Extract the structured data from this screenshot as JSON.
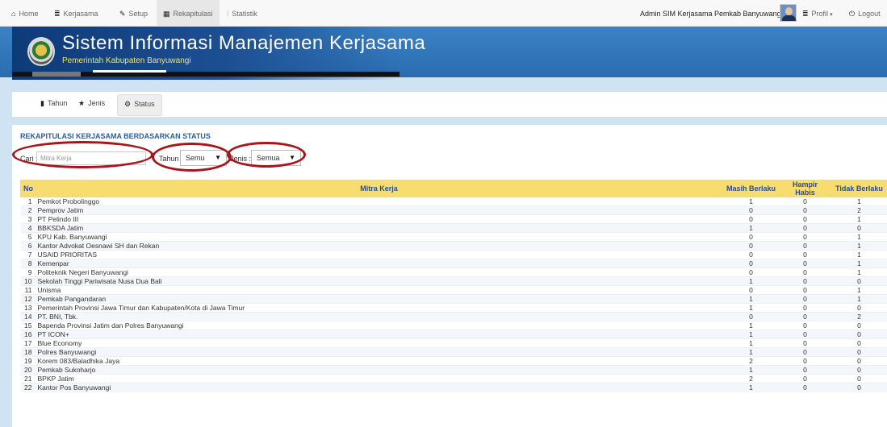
{
  "nav": {
    "items": [
      {
        "icon": "home-icon",
        "glyph": "🏠",
        "label": "Home"
      },
      {
        "icon": "list-icon",
        "glyph": "≣",
        "label": "Kerjasama"
      },
      {
        "icon": "wrench-icon",
        "glyph": "✎",
        "label": "Setup"
      },
      {
        "icon": "table-icon",
        "glyph": "▦",
        "label": "Rekapitulasi"
      },
      {
        "icon": "chart-icon",
        "glyph": "⫶",
        "label": "Statistik"
      }
    ],
    "admin_name": "Admin SIM Kerjasama Pemkab Banyuwangi",
    "profile_label": "Profil",
    "logout_label": "Logout"
  },
  "banner": {
    "title": "Sistem Informasi Manajemen Kerjasama",
    "subtitle": "Pemerintah Kabupaten Banyuwangi"
  },
  "tabs": [
    {
      "icon": "bookmark-icon",
      "label": "Tahun"
    },
    {
      "icon": "star-icon",
      "label": "Jenis"
    },
    {
      "icon": "gear-icon",
      "label": "Status"
    }
  ],
  "section_title": "REKAPITULASI KERJASAMA BERDASARKAN STATUS",
  "filters": {
    "cari_label": "Cari :",
    "cari_placeholder": "Mitra Kerja",
    "tahun_label": "Tahun :",
    "tahun_value": "Semu",
    "jenis_label": "Jenis :",
    "jenis_value": "Semua"
  },
  "table": {
    "headers": [
      "No",
      "Mitra Kerja",
      "Masih Berlaku",
      "Hampir Habis",
      "Tidak Berlaku"
    ],
    "rows": [
      [
        "1",
        "Pemkot Probolinggo",
        "1",
        "0",
        "1"
      ],
      [
        "2",
        "Pemprov Jatim",
        "0",
        "0",
        "2"
      ],
      [
        "3",
        "PT Pelindo III",
        "0",
        "0",
        "1"
      ],
      [
        "4",
        "BBKSDA Jatim",
        "1",
        "0",
        "0"
      ],
      [
        "5",
        "KPU Kab. Banyuwangi",
        "0",
        "0",
        "1"
      ],
      [
        "6",
        "Kantor Advokat Oesnawi SH dan Rekan",
        "0",
        "0",
        "1"
      ],
      [
        "7",
        "USAID PRIORITAS",
        "0",
        "0",
        "1"
      ],
      [
        "8",
        "Kemenpar",
        "0",
        "0",
        "1"
      ],
      [
        "9",
        "Politeknik Negeri Banyuwangi",
        "0",
        "0",
        "1"
      ],
      [
        "10",
        "Sekolah Tinggi Pariwisata Nusa Dua Bali",
        "1",
        "0",
        "0"
      ],
      [
        "11",
        "Unisma",
        "0",
        "0",
        "1"
      ],
      [
        "12",
        "Pemkab Pangandaran",
        "1",
        "0",
        "1"
      ],
      [
        "13",
        "Pemerintah Provinsi Jawa Timur dan Kabupaten/Kota di Jawa Timur",
        "1",
        "0",
        "0"
      ],
      [
        "14",
        "PT. BNI, Tbk.",
        "0",
        "0",
        "2"
      ],
      [
        "15",
        "Bapenda Provinsi Jatim dan Polres Banyuwangi",
        "1",
        "0",
        "0"
      ],
      [
        "16",
        "PT ICON+",
        "1",
        "0",
        "0"
      ],
      [
        "17",
        "Blue Economy",
        "1",
        "0",
        "0"
      ],
      [
        "18",
        "Polres Banyuwangi",
        "1",
        "0",
        "0"
      ],
      [
        "19",
        "Korem 083/Baladhika Jaya",
        "2",
        "0",
        "0"
      ],
      [
        "20",
        "Pemkab Sukoharjo",
        "1",
        "0",
        "0"
      ],
      [
        "21",
        "BPKP Jatim",
        "2",
        "0",
        "0"
      ],
      [
        "22",
        "Kantor Pos Banyuwangi",
        "1",
        "0",
        "0"
      ]
    ]
  },
  "colors": {
    "accent": "#2a5f9e",
    "header_bg": "#f7dc6f",
    "highlight": "#a8141a"
  }
}
